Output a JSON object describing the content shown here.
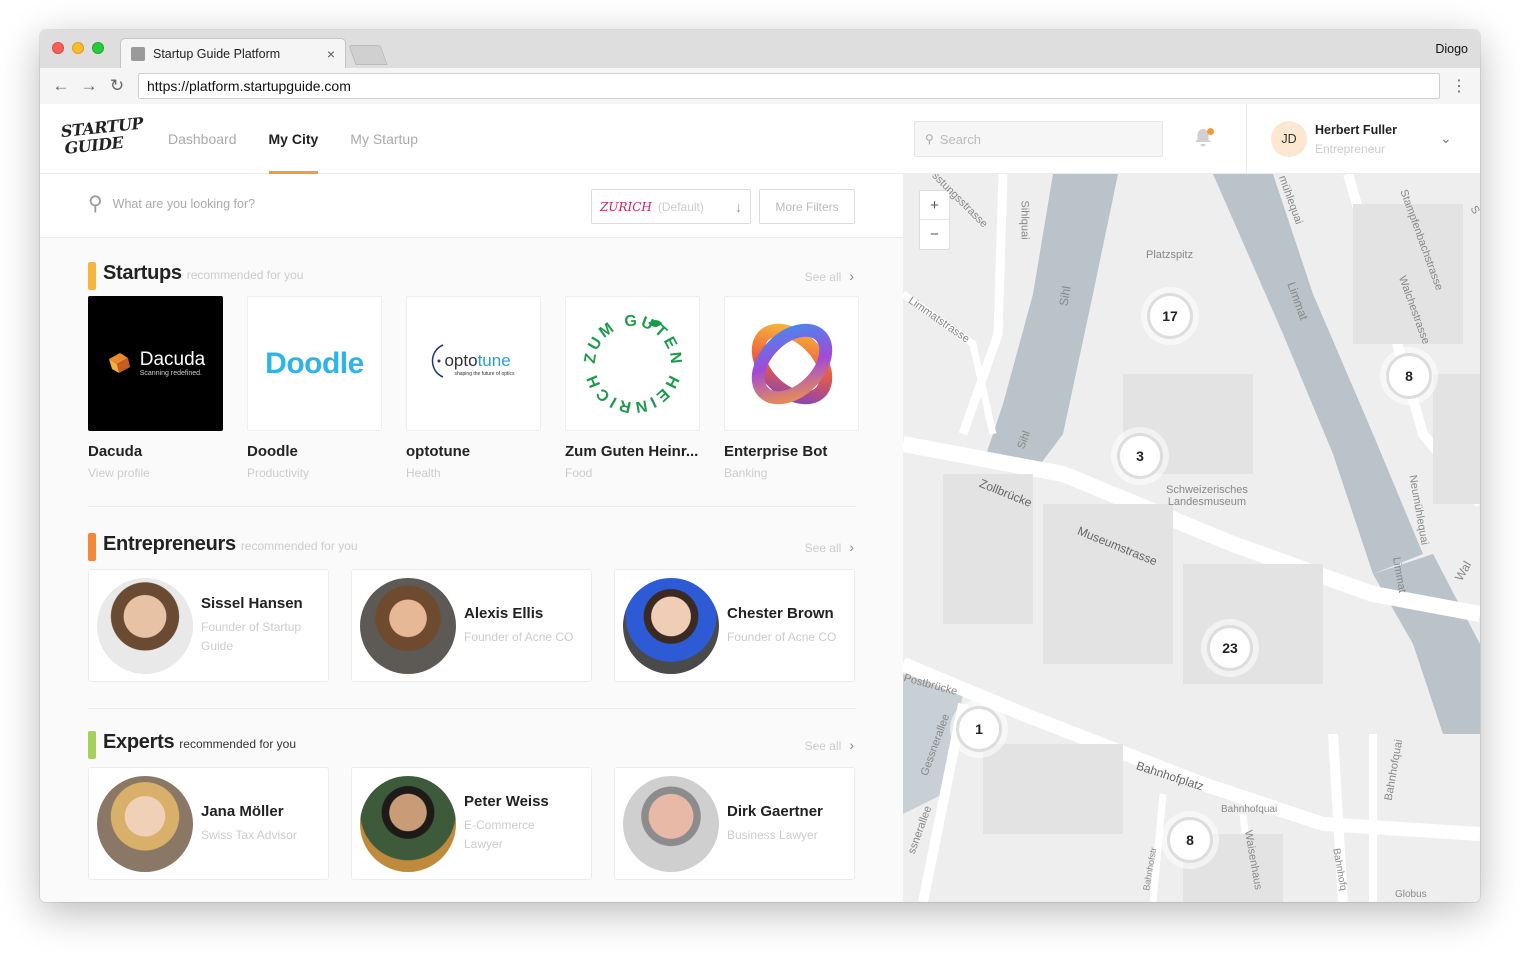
{
  "browser": {
    "tab_title": "Startup Guide Platform",
    "tab_close": "×",
    "profile_name": "Diogo",
    "url": "https://platform.startupguide.com",
    "back": "←",
    "forward": "→",
    "reload": "↻",
    "menu": "⋮"
  },
  "header": {
    "logo_line1": "STARTUP",
    "logo_line2": "GUIDE",
    "nav": [
      {
        "label": "Dashboard"
      },
      {
        "label": "My City"
      },
      {
        "label": "My Startup"
      }
    ],
    "search_placeholder": "Search",
    "user": {
      "initials": "JD",
      "name": "Herbert Fuller",
      "role": "Entrepreneur"
    },
    "accent_color": "#f39a3e"
  },
  "filters": {
    "search_placeholder": "What are you looking for?",
    "city": "ZURICH",
    "city_default": "(Default)",
    "more_filters": "More Filters"
  },
  "startups": {
    "title": "Startups",
    "subtitle": "recommended for you",
    "see_all": "See all",
    "bar_color": "#f6b63c",
    "items": [
      {
        "name": "Dacuda",
        "category": "View profile",
        "logo_text": "Dacuda",
        "logo_sub": "Scanning redefined."
      },
      {
        "name": "Doodle",
        "category": "Productivity",
        "logo_text": "Doodle"
      },
      {
        "name": "optotune",
        "category": "Health",
        "logo_text_a": "opto",
        "logo_text_b": "tune",
        "logo_sub": "shaping the future of optics"
      },
      {
        "name": "Zum Guten Heinr...",
        "category": "Food",
        "logo_text": "ZUM GUTEN HEINRICH"
      },
      {
        "name": "Enterprise Bot",
        "category": "Banking"
      }
    ]
  },
  "entrepreneurs": {
    "title": "Entrepreneurs",
    "subtitle": "recommended for you",
    "see_all": "See all",
    "bar_color": "#f3873a",
    "items": [
      {
        "name": "Sissel Hansen",
        "role": "Founder of Startup Guide"
      },
      {
        "name": "Alexis Ellis",
        "role": "Founder of Acne CO"
      },
      {
        "name": "Chester Brown",
        "role": "Founder of Acne CO"
      }
    ]
  },
  "experts": {
    "title": "Experts",
    "subtitle": "recommended for you",
    "see_all": "See all",
    "bar_color": "#a6d05a",
    "items": [
      {
        "name": "Jana Möller",
        "role": "Swiss Tax Advisor"
      },
      {
        "name": "Peter Weiss",
        "role": "E-Commerce Lawyer"
      },
      {
        "name": "Dirk Gaertner",
        "role": "Business Lawyer"
      }
    ]
  },
  "map": {
    "zoom_in": "+",
    "zoom_out": "−",
    "clusters": [
      "17",
      "8",
      "3",
      "23",
      "1",
      "8"
    ],
    "labels": {
      "platzspitz": "Platzspitz",
      "museum": "Schweizerisches",
      "museum2": "Landesmuseum",
      "zollbruecke": "Zollbrücke",
      "museumstrasse": "Museumstrasse",
      "bahnhofplatz": "Bahnhofplatz",
      "bahnhofquai": "Bahnhofquai",
      "limmat": "Limmat",
      "sihl": "Sihl",
      "sihlquai": "Sihlquai",
      "neumuehlequai": "Neumühlequai",
      "stampfenbachstrasse": "Stampfenbachstrasse",
      "globus": "Globus",
      "limmatstrasse": "Limmatstrasse",
      "walchestrasse": "Walchestrasse",
      "postbruecke": "Postbrücke",
      "gessnerallee": "Gessnerallee",
      "bahnhofquai_v": "Bahnhofquai",
      "muehlequai": "mühlequai",
      "sihl2": "Sihl",
      "limmat2": "Limmat",
      "waisenhaus": "Waisenhaus",
      "bahnhofstr": "Bahnhofstr",
      "ssnerallee": "ssnerallee",
      "bahnhofq2": "Bahnhofq",
      "wal": "Wal",
      "ssstrasse": "sstungsstrasse",
      "s": "S"
    }
  }
}
